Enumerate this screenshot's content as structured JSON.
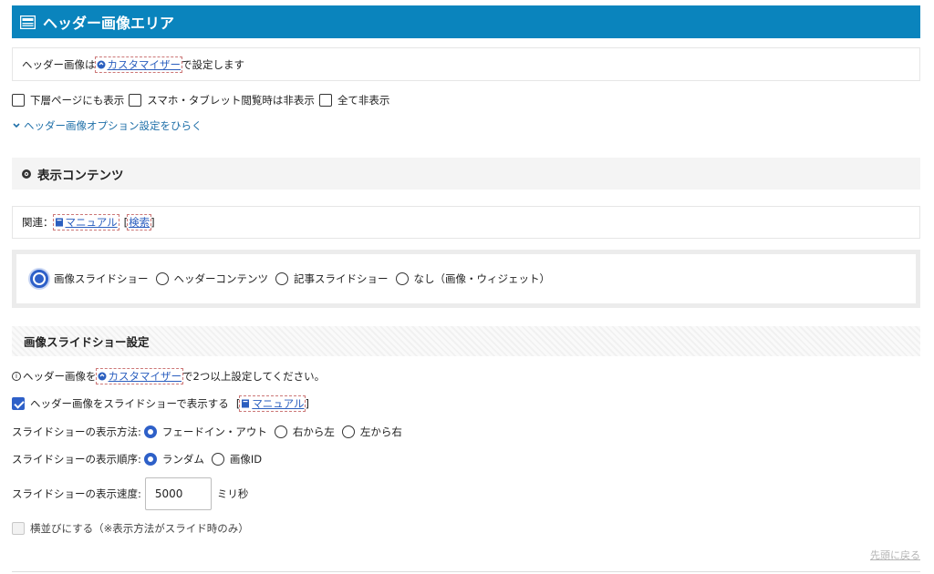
{
  "header": {
    "title": "ヘッダー画像エリア",
    "icon": "layout-icon"
  },
  "notice": {
    "prefix": "ヘッダー画像は",
    "link": "カスタマイザー",
    "suffix": "で設定します"
  },
  "display_options": [
    {
      "label": "下層ページにも表示",
      "checked": false
    },
    {
      "label": "スマホ・タブレット閲覧時は非表示",
      "checked": false
    },
    {
      "label": "全て非表示",
      "checked": false
    }
  ],
  "options_toggle": "ヘッダー画像オプション設定をひらく",
  "content_section": {
    "title": "表示コンテンツ",
    "related_prefix": "関連：",
    "manual_link": "マニュアル",
    "search_link": "検索",
    "radios": [
      {
        "label": "画像スライドショー",
        "selected": true
      },
      {
        "label": "ヘッダーコンテンツ",
        "selected": false
      },
      {
        "label": "記事スライドショー",
        "selected": false
      },
      {
        "label": "なし（画像・ウィジェット）",
        "selected": false
      }
    ]
  },
  "slideshow": {
    "title": "画像スライドショー設定",
    "info_prefix": "ヘッダー画像を",
    "info_link": "カスタマイザー",
    "info_suffix": "で2つ以上設定してください。",
    "show_as_slideshow": {
      "label": "ヘッダー画像をスライドショーで表示する",
      "checked": true,
      "manual_link": "マニュアル"
    },
    "method": {
      "label": "スライドショーの表示方法:",
      "options": [
        {
          "label": "フェードイン・アウト",
          "selected": true
        },
        {
          "label": "右から左",
          "selected": false
        },
        {
          "label": "左から右",
          "selected": false
        }
      ]
    },
    "order": {
      "label": "スライドショーの表示順序:",
      "options": [
        {
          "label": "ランダム",
          "selected": true
        },
        {
          "label": "画像ID",
          "selected": false
        }
      ]
    },
    "speed": {
      "label": "スライドショーの表示速度:",
      "value": "5000",
      "unit": "ミリ秒"
    },
    "horizontal": {
      "label": "横並びにする（※表示方法がスライド時のみ）",
      "checked": false,
      "disabled": true
    }
  },
  "back_to_top": "先頭に戻る",
  "colors": {
    "header_bg": "#0a84bd",
    "accent": "#2e60c8",
    "link": "#1e6fa8"
  }
}
